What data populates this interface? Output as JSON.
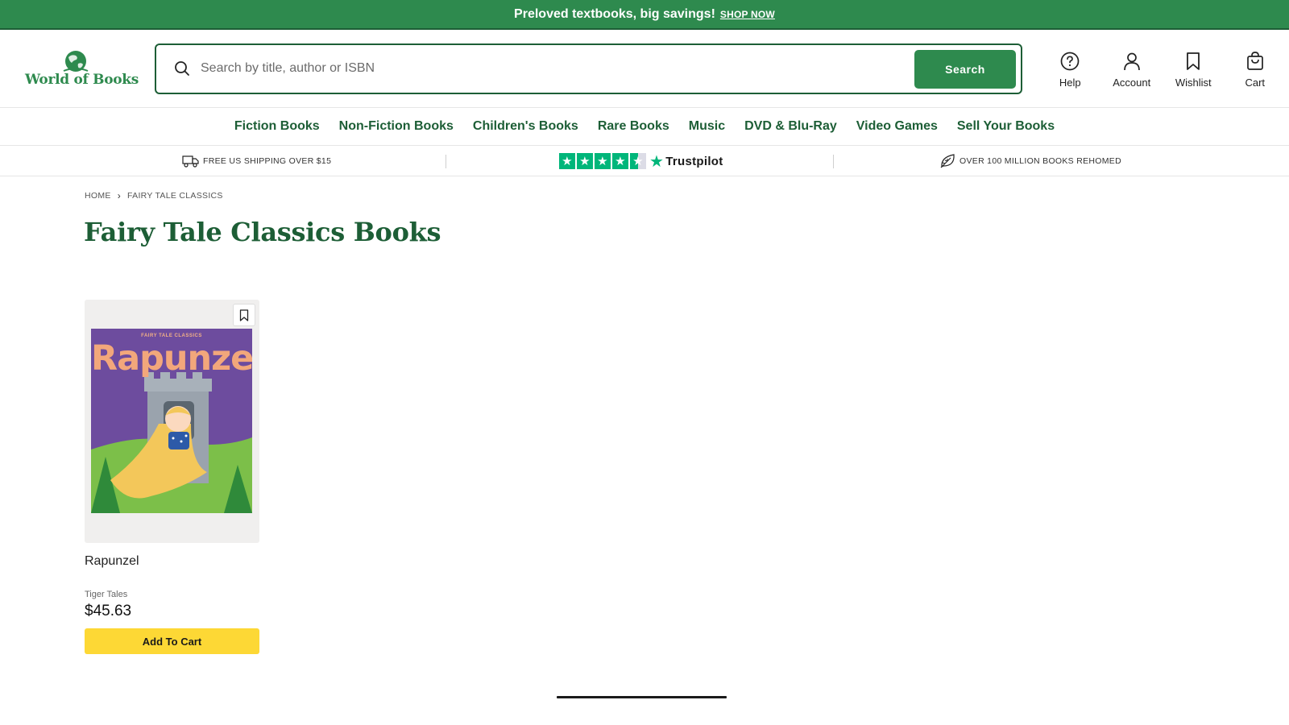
{
  "promo": {
    "text": "Preloved textbooks, big savings!",
    "link": "SHOP NOW"
  },
  "header": {
    "logo_text": "World of Books",
    "search": {
      "placeholder": "Search by title, author or ISBN",
      "value": "",
      "button_label": "Search"
    },
    "actions": [
      {
        "label": "Help",
        "icon": "help-icon"
      },
      {
        "label": "Account",
        "icon": "account-icon"
      },
      {
        "label": "Wishlist",
        "icon": "bookmark-icon"
      },
      {
        "label": "Cart",
        "icon": "cart-icon"
      }
    ]
  },
  "nav": {
    "items": [
      "Fiction Books",
      "Non-Fiction Books",
      "Children's Books",
      "Rare Books",
      "Music",
      "DVD & Blu-Ray",
      "Video Games",
      "Sell Your Books"
    ]
  },
  "trust_bar": {
    "shipping": "FREE US SHIPPING OVER $15",
    "trustpilot": "Trustpilot",
    "trustpilot_rating_stars": 4.5,
    "rehomed": "OVER 100 MILLION BOOKS REHOMED"
  },
  "breadcrumb": {
    "home": "HOME",
    "current": "FAIRY TALE CLASSICS"
  },
  "page_title": "Fairy Tale Classics Books",
  "products": [
    {
      "title": "Rapunzel",
      "cover_series": "FAIRY TALE CLASSICS",
      "cover_title": "Rapunzel",
      "author": "Tiger Tales",
      "price": "$45.63",
      "button_label": "Add To Cart"
    }
  ],
  "colors": {
    "brand_green": "#2e8a4e",
    "dark_green": "#1d5e36",
    "add_to_cart_yellow": "#fdd835",
    "trustpilot_green": "#00b67a"
  }
}
